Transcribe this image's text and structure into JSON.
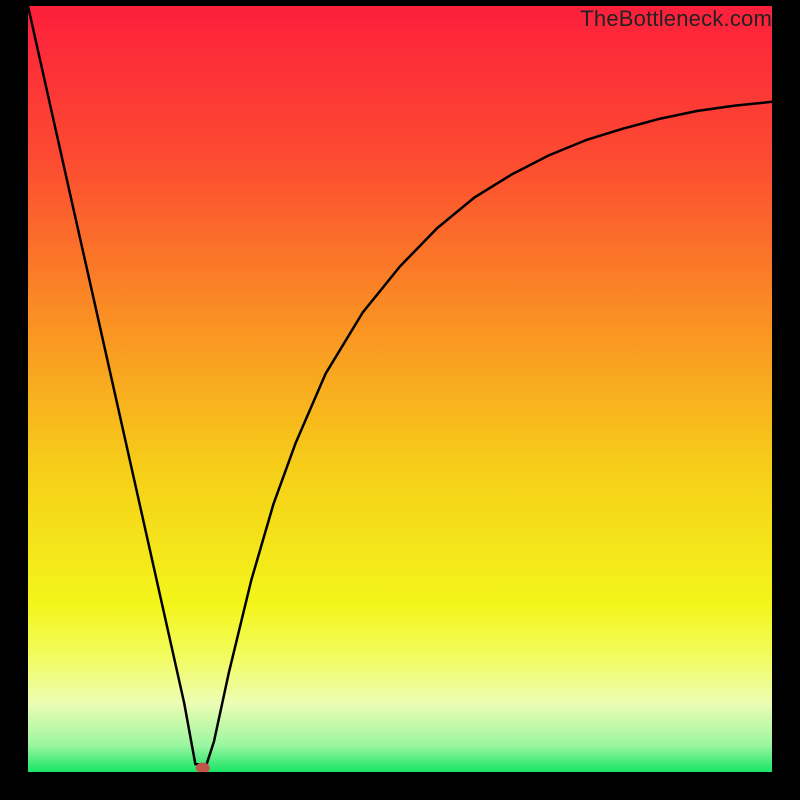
{
  "watermark": {
    "text": "TheBottleneck.com"
  },
  "chart_data": {
    "type": "line",
    "title": "",
    "xlabel": "",
    "ylabel": "",
    "xlim": [
      0,
      100
    ],
    "ylim": [
      0,
      100
    ],
    "grid": false,
    "legend": false,
    "series": [
      {
        "name": "bottleneck-curve",
        "x": [
          0,
          3,
          6,
          9,
          12,
          15,
          18,
          21,
          22.5,
          24,
          25,
          27,
          30,
          33,
          36,
          40,
          45,
          50,
          55,
          60,
          65,
          70,
          75,
          80,
          85,
          90,
          95,
          100
        ],
        "values": [
          100,
          87,
          74,
          61,
          48,
          35,
          22,
          9,
          1,
          1,
          4,
          13,
          25,
          35,
          43,
          52,
          60,
          66,
          71,
          75,
          78,
          80.5,
          82.5,
          84,
          85.3,
          86.3,
          87,
          87.5
        ]
      }
    ],
    "marker": {
      "name": "current-point",
      "x": 23.5,
      "y": 0,
      "color": "#c0564b"
    },
    "background_gradient": {
      "stops": [
        {
          "offset": 0.0,
          "color": "#fd1f3c"
        },
        {
          "offset": 0.2,
          "color": "#fc4b31"
        },
        {
          "offset": 0.4,
          "color": "#fa8d24"
        },
        {
          "offset": 0.6,
          "color": "#f6cd19"
        },
        {
          "offset": 0.78,
          "color": "#f3f51a"
        },
        {
          "offset": 0.85,
          "color": "#f2fc60"
        },
        {
          "offset": 0.91,
          "color": "#edfdb4"
        },
        {
          "offset": 0.965,
          "color": "#9bf6a0"
        },
        {
          "offset": 1.0,
          "color": "#18e465"
        }
      ]
    }
  }
}
